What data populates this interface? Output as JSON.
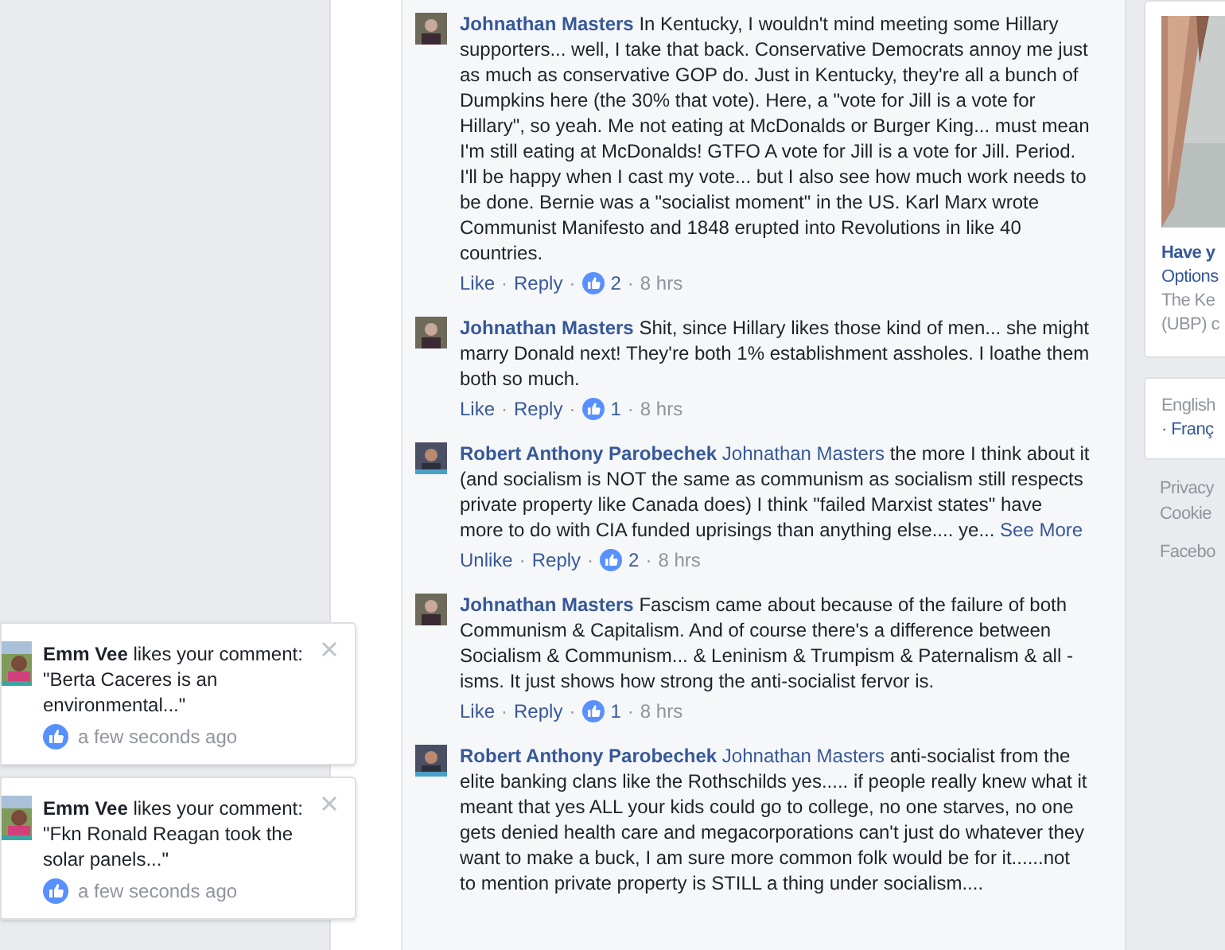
{
  "comments": [
    {
      "author": "Johnathan Masters",
      "text": "In Kentucky, I wouldn't mind meeting some Hillary supporters... well, I take that back. Conservative Democrats annoy me just as much as conservative GOP do. Just in Kentucky, they're all a bunch of Dumpkins here (the 30% that vote). Here, a \"vote for Jill is a vote for Hillary\", so yeah. Me not eating at McDonalds or Burger King... must mean I'm still eating at McDonalds! GTFO A vote for Jill is a vote for Jill. Period. I'll be happy when I cast my vote... but I also see how much work needs to be done. Bernie was a \"socialist moment\" in the US. Karl Marx wrote Communist Manifesto and 1848 erupted into Revolutions in like 40 countries.",
      "like_label": "Like",
      "reply_label": "Reply",
      "likes": "2",
      "time": "8 hrs",
      "dots": [
        "·",
        "·",
        "·"
      ]
    },
    {
      "author": "Johnathan Masters",
      "text": "Shit, since Hillary likes those kind of men... she might marry Donald next! They're both 1% establishment assholes. I loathe them both so much.",
      "like_label": "Like",
      "reply_label": "Reply",
      "likes": "1",
      "time": "8 hrs",
      "dots": [
        "·",
        "·",
        "·"
      ]
    },
    {
      "author": "Robert Anthony Parobechek",
      "mention": "Johnathan Masters",
      "text": "the more I think about it (and socialism is NOT the same as communism as socialism still respects private property like Canada does) I think \"failed Marxist states\" have more to do with CIA funded uprisings than anything else.... ye...",
      "see_more": "See More",
      "like_label": "Unlike",
      "reply_label": "Reply",
      "likes": "2",
      "time": "8 hrs",
      "dots": [
        "·",
        "·",
        "·"
      ]
    },
    {
      "author": "Johnathan Masters",
      "text": "Fascism came about because of the failure of both Communism & Capitalism. And of course there's a difference between Socialism & Communism... & Leninism & Trumpism & Paternalism & all -isms. It just shows how strong the anti-socialist fervor is.",
      "like_label": "Like",
      "reply_label": "Reply",
      "likes": "1",
      "time": "8 hrs",
      "dots": [
        "·",
        "·",
        "·"
      ]
    },
    {
      "author": "Robert Anthony Parobechek",
      "mention": "Johnathan Masters",
      "text": "anti-socialist from the elite banking clans like the Rothschilds yes..... if people really knew what it meant that yes ALL your kids could go to college, no one starves, no one gets denied health care and megacorporations can't just do whatever they want to make a buck, I am sure more common folk would be for it......not to mention private property is STILL a thing under socialism...."
    }
  ],
  "sidebar": {
    "ad": {
      "title": "Have y",
      "link": "Options",
      "lines": [
        "The Ke",
        "(UBP) c"
      ]
    },
    "languages": {
      "current": "English",
      "other": "· Franç"
    },
    "footer": [
      "Privacy",
      "Cookie",
      "Facebo"
    ]
  },
  "notifications": [
    {
      "actor": "Emm Vee",
      "action": "likes your comment:",
      "quote": "\"Berta Caceres is an environmental...\"",
      "time": "a few seconds ago"
    },
    {
      "actor": "Emm Vee",
      "action": "likes your comment:",
      "quote": "\"Fkn Ronald Reagan took the solar panels...\"",
      "time": "a few seconds ago"
    }
  ]
}
